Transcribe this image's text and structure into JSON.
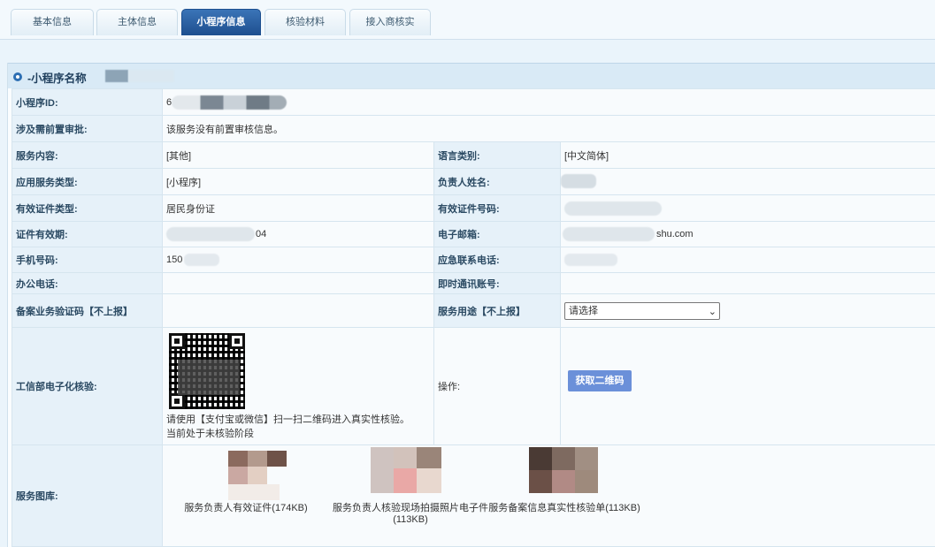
{
  "tabs": [
    "基本信息",
    "主体信息",
    "小程序信息",
    "核验材料",
    "接入商核实"
  ],
  "active_tab": "小程序信息",
  "section_title": "-小程序名称",
  "fields": {
    "app_id_label": "小程序ID:",
    "app_id_value": "6",
    "pre_approval_label": "涉及需前置审批:",
    "pre_approval_value": "该服务没有前置审核信息。",
    "service_content_label": "服务内容:",
    "service_content_value": "[其他]",
    "language_label": "语言类别:",
    "language_value": "[中文简体]",
    "app_service_type_label": "应用服务类型:",
    "app_service_type_value": "[小程序]",
    "owner_name_label": "负责人姓名:",
    "owner_name_value": "",
    "id_type_label": "有效证件类型:",
    "id_type_value": "居民身份证",
    "id_number_label": "有效证件号码:",
    "id_number_value": "",
    "id_validity_label": "证件有效期:",
    "id_validity_value": "04",
    "email_label": "电子邮箱:",
    "email_value": "shu.com",
    "phone_label": "手机号码:",
    "phone_value": "150",
    "emergency_phone_label": "应急联系电话:",
    "emergency_phone_value": "",
    "office_phone_label": "办公电话:",
    "office_phone_value": "",
    "im_account_label": "即时通讯账号:",
    "im_account_value": "",
    "filing_code_label": "备案业务验证码【不上报】",
    "filing_code_value": "",
    "service_use_label": "服务用途【不上报】",
    "service_use_selected": "请选择",
    "miit_verify_label": "工信部电子化核验:",
    "miit_instruction": "请使用【支付宝或微信】扫一扫二维码进入真实性核验。",
    "miit_status": "当前处于未核验阶段",
    "operation_label": "操作:",
    "get_qr_button": "获取二维码",
    "gallery_label": "服务图库:"
  },
  "gallery": [
    "服务负责人有效证件(174KB)",
    "服务负责人核验现场拍摄照片电子件(113KB)",
    "服务备案信息真实性核验单(113KB)"
  ],
  "colors": {
    "active_tab": "#1d4f8f",
    "label_bg": "#e6f1f9",
    "button": "#6b90d9"
  }
}
